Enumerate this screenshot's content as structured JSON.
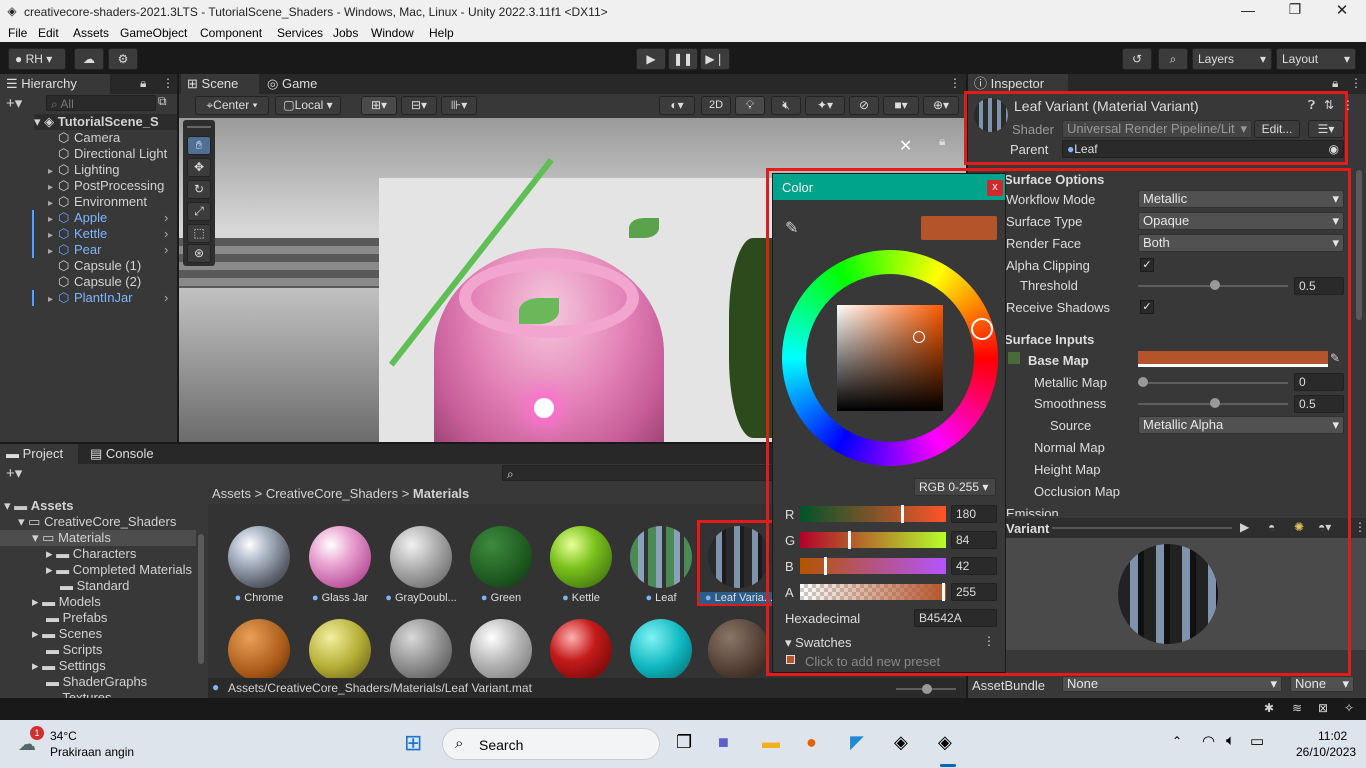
{
  "window": {
    "title": "creativecore-shaders-2021.3LTS - TutorialScene_Shaders - Windows, Mac, Linux - Unity 2022.3.11f1 <DX11>"
  },
  "menu": [
    "File",
    "Edit",
    "Assets",
    "GameObject",
    "Component",
    "Services",
    "Jobs",
    "Window",
    "Help"
  ],
  "toolbar": {
    "account": "RH",
    "layers": "Layers",
    "layout": "Layout"
  },
  "hierarchy": {
    "tab": "Hierarchy",
    "search_placeholder": "All",
    "scene": "TutorialScene_S",
    "items": [
      {
        "label": "Camera",
        "prefab": false
      },
      {
        "label": "Directional Light",
        "prefab": false
      },
      {
        "label": "Lighting",
        "prefab": false
      },
      {
        "label": "PostProcessing",
        "prefab": false
      },
      {
        "label": "Environment",
        "prefab": false
      },
      {
        "label": "Apple",
        "prefab": true
      },
      {
        "label": "Kettle",
        "prefab": true
      },
      {
        "label": "Pear",
        "prefab": true
      },
      {
        "label": "Capsule (1)",
        "prefab": false
      },
      {
        "label": "Capsule (2)",
        "prefab": false
      },
      {
        "label": "PlantInJar",
        "prefab": true
      }
    ]
  },
  "scene": {
    "tab_scene": "Scene",
    "tab_game": "Game",
    "pivot": "Center",
    "space": "Local",
    "mode2d": "2D"
  },
  "project": {
    "tab_project": "Project",
    "tab_console": "Console",
    "tree": {
      "assets": "Assets",
      "creativecore": "CreativeCore_Shaders",
      "materials": "Materials",
      "characters": "Characters",
      "completed": "Completed Materials",
      "standard": "Standard",
      "models": "Models",
      "prefabs": "Prefabs",
      "scenes": "Scenes",
      "scripts": "Scripts",
      "settings": "Settings",
      "shadergraphs": "ShaderGraphs",
      "textures": "Textures"
    },
    "breadcrumb": [
      "Assets",
      "CreativeCore_Shaders",
      "Materials"
    ],
    "assets_row1": [
      "Chrome",
      "Glass Jar",
      "GrayDoubl...",
      "Green",
      "Kettle",
      "Leaf",
      "Leaf Varia..."
    ],
    "status_path": "Assets/CreativeCore_Shaders/Materials/Leaf Variant.mat"
  },
  "inspector": {
    "tab": "Inspector",
    "title": "Leaf Variant (Material Variant)",
    "shader_label": "Shader",
    "shader_value": "Universal Render Pipeline/Lit",
    "edit_button": "Edit...",
    "parent_label": "Parent",
    "parent_value": "Leaf",
    "surface_options": "Surface Options",
    "workflow_label": "Workflow Mode",
    "workflow_value": "Metallic",
    "surface_type_label": "Surface Type",
    "surface_type_value": "Opaque",
    "render_face_label": "Render Face",
    "render_face_value": "Both",
    "alpha_clip_label": "Alpha Clipping",
    "threshold_label": "Threshold",
    "threshold_value": "0.5",
    "receive_shadows_label": "Receive Shadows",
    "surface_inputs": "Surface Inputs",
    "base_map": "Base Map",
    "metallic_map": "Metallic Map",
    "metallic_value": "0",
    "smoothness": "Smoothness",
    "smoothness_value": "0.5",
    "source": "Source",
    "source_value": "Metallic Alpha",
    "normal_map": "Normal Map",
    "height_map": "Height Map",
    "occlusion_map": "Occlusion Map",
    "emission": "Emission",
    "preview_title": "Variant",
    "assetbundle_label": "AssetBundle",
    "assetbundle_value": "None",
    "assetbundle_variant": "None",
    "base_color": "#b4542a"
  },
  "color_picker": {
    "title": "Color",
    "close": "x",
    "mode": "RGB 0-255",
    "r_label": "R",
    "r": "180",
    "g_label": "G",
    "g": "84",
    "b_label": "B",
    "b": "42",
    "a_label": "A",
    "a": "255",
    "hex_label": "Hexadecimal",
    "hex": "B4542A",
    "swatches": "Swatches",
    "add_preset": "Click to add new preset"
  },
  "taskbar": {
    "weather_temp": "34°C",
    "weather_desc": "Prakiraan angin",
    "weather_badge": "1",
    "search": "Search",
    "time": "11:02",
    "date": "26/10/2023"
  }
}
